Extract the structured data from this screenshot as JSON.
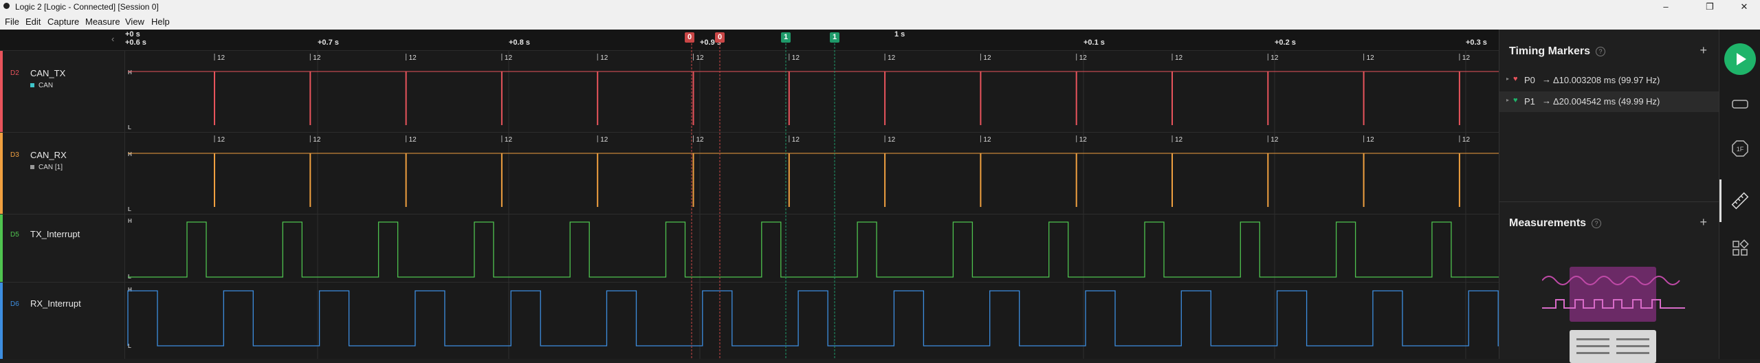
{
  "window": {
    "title": "Logic 2 [Logic - Connected] [Session 0]",
    "minimize": "–",
    "maximize": "❐",
    "close": "✕"
  },
  "menu": [
    "File",
    "Edit",
    "Capture",
    "Measure",
    "View",
    "Help"
  ],
  "ruler": {
    "origin_top": "+0 s",
    "origin": "+0.6 s",
    "ticks": [
      "+0.7 s",
      "+0.8 s",
      "+0.9 s",
      "+0.1 s",
      "+0.2 s",
      "+0.3 s"
    ],
    "center_label": "1 s",
    "marker_flags": [
      {
        "text": "0",
        "color": "#c94646"
      },
      {
        "text": "0",
        "color": "#c94646"
      },
      {
        "text": "1",
        "color": "#1f9a6a"
      },
      {
        "text": "1",
        "color": "#1f9a6a"
      }
    ]
  },
  "channels": [
    {
      "id": "D2",
      "name": "CAN_TX",
      "color": "#e8545c",
      "analyzer": "CAN",
      "analyzer_color": "#3fc4c9",
      "high": "H",
      "low": "L",
      "packet_label": "12"
    },
    {
      "id": "D3",
      "name": "CAN_RX",
      "color": "#f0a040",
      "analyzer": "CAN [1]",
      "analyzer_color": "#999999",
      "high": "H",
      "low": "L",
      "packet_label": "12"
    },
    {
      "id": "D5",
      "name": "TX_Interrupt",
      "color": "#4fc34f",
      "high": "H",
      "low": "L"
    },
    {
      "id": "D6",
      "name": "RX_Interrupt",
      "color": "#3d8ee0",
      "high": "H",
      "low": "L"
    }
  ],
  "timing_markers": {
    "title": "Timing Markers",
    "help": "?",
    "add": "+",
    "items": [
      {
        "name": "P0",
        "heart_color": "#e8545c",
        "arrow": "→",
        "value": "Δ10.003208 ms (99.97 Hz)"
      },
      {
        "name": "P1",
        "heart_color": "#1fb46a",
        "arrow": "→",
        "value": "Δ20.004542 ms (49.99 Hz)"
      }
    ]
  },
  "measurements": {
    "title": "Measurements",
    "help": "?",
    "add": "+"
  },
  "rail": {
    "play": "start-capture",
    "items": [
      "device-icon",
      "analyzers-icon",
      "timing-markers-icon",
      "extensions-icon"
    ]
  }
}
